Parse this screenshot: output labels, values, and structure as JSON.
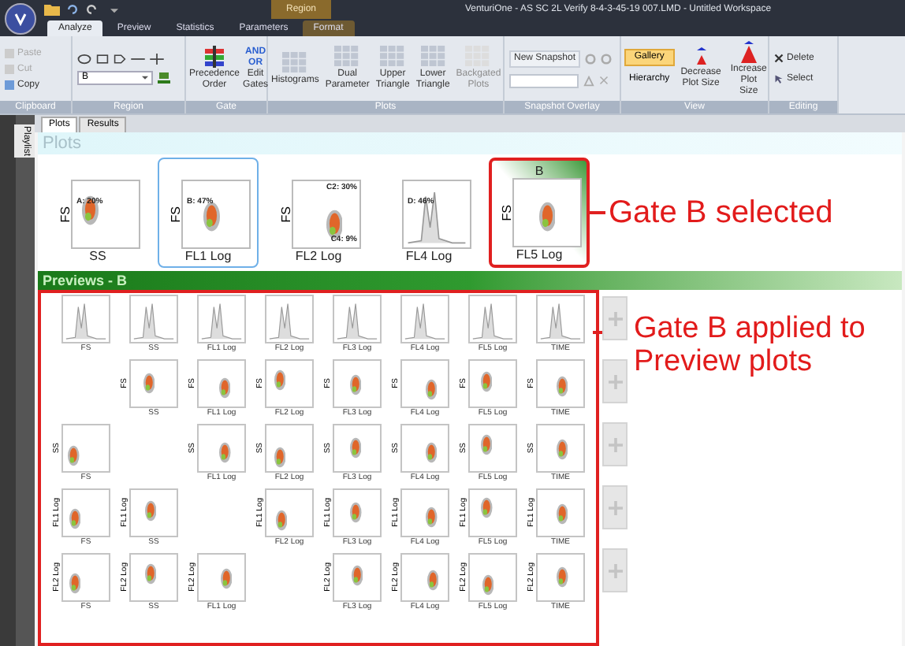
{
  "title_bar": {
    "contextual_tab": "Region",
    "title": "VenturiOne - AS SC 2L Verify 8-4-3-45-19 007.LMD - Untitled Workspace"
  },
  "ribbon_tabs": [
    {
      "label": "Analyze",
      "selected": true
    },
    {
      "label": "Preview",
      "selected": false
    },
    {
      "label": "Statistics",
      "selected": false
    },
    {
      "label": "Parameters",
      "selected": false
    },
    {
      "label": "Format",
      "selected": false
    }
  ],
  "ribbon": {
    "clipboard": {
      "label": "Clipboard",
      "buttons": [
        {
          "label": "Paste",
          "disabled": true
        },
        {
          "label": "Cut",
          "disabled": true
        },
        {
          "label": "Copy",
          "disabled": false
        }
      ]
    },
    "region": {
      "label": "Region",
      "selector_value": "B"
    },
    "gate": {
      "label": "Gate",
      "precedence": "Precedence Order",
      "logic_and": "AND",
      "logic_or": "OR",
      "edit": "Edit Gates"
    },
    "plots": {
      "label": "Plots",
      "buttons": [
        {
          "label": "Histograms",
          "disabled": false
        },
        {
          "label": "Dual Parameter",
          "disabled": false
        },
        {
          "label": "Upper Triangle",
          "disabled": false
        },
        {
          "label": "Lower Triangle",
          "disabled": false
        },
        {
          "label": "Backgated Plots",
          "disabled": true
        }
      ]
    },
    "snapshot": {
      "label": "Snapshot Overlay",
      "new": "New Snapshot"
    },
    "view": {
      "label": "View",
      "modes": [
        {
          "label": "Gallery",
          "selected": true
        },
        {
          "label": "Hierarchy",
          "selected": false
        }
      ],
      "decrease": "Decrease Plot Size",
      "increase": "Increase Plot Size"
    },
    "editing": {
      "label": "Editing",
      "delete": "Delete",
      "select": "Select"
    }
  },
  "sidebar_tab": "Playlist",
  "document_tabs": [
    {
      "label": "Plots",
      "selected": true
    },
    {
      "label": "Results",
      "selected": false
    }
  ],
  "plots": {
    "title": "Plots",
    "items": [
      {
        "x_label": "SS",
        "y_label": "FS",
        "gate_labels": [
          "A: 20%"
        ],
        "kind": "scatter",
        "selected": false,
        "highlighted": false
      },
      {
        "x_label": "FL1 Log",
        "y_label": "FS",
        "gate_labels": [
          "B: 47%"
        ],
        "kind": "scatter",
        "selected": true,
        "highlighted": false
      },
      {
        "x_label": "FL2 Log",
        "y_label": "FS",
        "gate_labels": [
          "C2: 30%",
          "C4: 9%"
        ],
        "kind": "scatter",
        "selected": false,
        "highlighted": false
      },
      {
        "x_label": "FL4 Log",
        "gate_labels": [
          "D: 46%"
        ],
        "kind": "histogram",
        "selected": false,
        "highlighted": false
      },
      {
        "x_label": "FL5 Log",
        "y_label": "FS",
        "header": "B",
        "kind": "scatter",
        "selected": false,
        "highlighted": true
      }
    ]
  },
  "annotations": [
    "Gate B selected",
    "Gate B applied to Preview plots"
  ],
  "previews": {
    "title": "Previews - B",
    "rows": [
      {
        "cells": [
          {
            "kind": "histogram",
            "x_label": "FS"
          },
          {
            "kind": "histogram",
            "x_label": "SS"
          },
          {
            "kind": "histogram",
            "x_label": "FL1 Log"
          },
          {
            "kind": "histogram",
            "x_label": "FL2 Log"
          },
          {
            "kind": "histogram",
            "x_label": "FL3 Log"
          },
          {
            "kind": "histogram",
            "x_label": "FL4 Log"
          },
          {
            "kind": "histogram",
            "x_label": "FL5 Log"
          },
          {
            "kind": "histogram",
            "x_label": "TIME"
          }
        ]
      },
      {
        "cells": [
          {
            "kind": "empty"
          },
          {
            "kind": "scatter",
            "x_label": "SS",
            "y_label": "FS"
          },
          {
            "kind": "scatter",
            "x_label": "FL1 Log",
            "y_label": "FS"
          },
          {
            "kind": "scatter",
            "x_label": "FL2 Log",
            "y_label": "FS"
          },
          {
            "kind": "scatter",
            "x_label": "FL3 Log",
            "y_label": "FS"
          },
          {
            "kind": "scatter",
            "x_label": "FL4 Log",
            "y_label": "FS"
          },
          {
            "kind": "scatter",
            "x_label": "FL5 Log",
            "y_label": "FS"
          },
          {
            "kind": "scatter",
            "x_label": "TIME",
            "y_label": "FS"
          }
        ]
      },
      {
        "cells": [
          {
            "kind": "scatter",
            "x_label": "FS",
            "y_label": "SS"
          },
          {
            "kind": "empty"
          },
          {
            "kind": "scatter",
            "x_label": "FL1 Log",
            "y_label": "SS"
          },
          {
            "kind": "scatter",
            "x_label": "FL2 Log",
            "y_label": "SS"
          },
          {
            "kind": "scatter",
            "x_label": "FL3 Log",
            "y_label": "SS"
          },
          {
            "kind": "scatter",
            "x_label": "FL4 Log",
            "y_label": "SS"
          },
          {
            "kind": "scatter",
            "x_label": "FL5 Log",
            "y_label": "SS"
          },
          {
            "kind": "scatter",
            "x_label": "TIME",
            "y_label": "SS"
          }
        ]
      },
      {
        "cells": [
          {
            "kind": "scatter",
            "x_label": "FS",
            "y_label": "FL1 Log"
          },
          {
            "kind": "scatter",
            "x_label": "SS",
            "y_label": "FL1 Log"
          },
          {
            "kind": "empty"
          },
          {
            "kind": "scatter",
            "x_label": "FL2 Log",
            "y_label": "FL1 Log"
          },
          {
            "kind": "scatter",
            "x_label": "FL3 Log",
            "y_label": "FL1 Log"
          },
          {
            "kind": "scatter",
            "x_label": "FL4 Log",
            "y_label": "FL1 Log"
          },
          {
            "kind": "scatter",
            "x_label": "FL5 Log",
            "y_label": "FL1 Log"
          },
          {
            "kind": "scatter",
            "x_label": "TIME",
            "y_label": "FL1 Log"
          }
        ]
      },
      {
        "cells": [
          {
            "kind": "scatter",
            "x_label": "FS",
            "y_label": "FL2 Log"
          },
          {
            "kind": "scatter",
            "x_label": "SS",
            "y_label": "FL2 Log"
          },
          {
            "kind": "scatter",
            "x_label": "FL1 Log",
            "y_label": "FL2 Log"
          },
          {
            "kind": "empty"
          },
          {
            "kind": "scatter",
            "x_label": "FL3 Log",
            "y_label": "FL2 Log"
          },
          {
            "kind": "scatter",
            "x_label": "FL4 Log",
            "y_label": "FL2 Log"
          },
          {
            "kind": "scatter",
            "x_label": "FL5 Log",
            "y_label": "FL2 Log"
          },
          {
            "kind": "scatter",
            "x_label": "TIME",
            "y_label": "FL2 Log"
          }
        ]
      }
    ]
  }
}
